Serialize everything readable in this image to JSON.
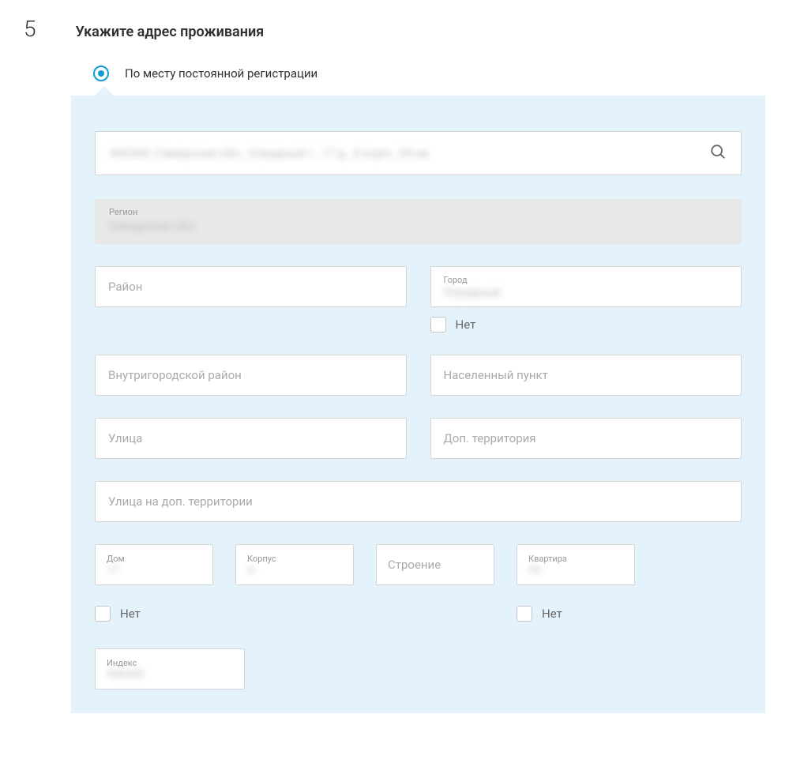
{
  "step": {
    "number": "5",
    "title": "Укажите адрес проживания"
  },
  "radio": {
    "label": "По месту постоянной регистрации"
  },
  "search": {
    "value": "446300, Самарская обл., Отрадный г., 17 д., А корп., 34 кв."
  },
  "region": {
    "label": "Регион",
    "value": "Самарская обл."
  },
  "fields": {
    "district": {
      "placeholder": "Район"
    },
    "city": {
      "label": "Город",
      "value": "Отрадный",
      "noLabel": "Нет"
    },
    "innerDistrict": {
      "placeholder": "Внутригородской район"
    },
    "locality": {
      "placeholder": "Населенный пункт"
    },
    "street": {
      "placeholder": "Улица"
    },
    "addTerritory": {
      "placeholder": "Доп. территория"
    },
    "streetAddTerritory": {
      "placeholder": "Улица на доп. территории"
    },
    "house": {
      "label": "Дом",
      "value": "17",
      "noLabel": "Нет"
    },
    "corpus": {
      "label": "Корпус",
      "value": "А"
    },
    "building": {
      "placeholder": "Строение"
    },
    "flat": {
      "label": "Квартира",
      "value": "34",
      "noLabel": "Нет"
    },
    "index": {
      "label": "Индекс",
      "value": "446300"
    }
  }
}
